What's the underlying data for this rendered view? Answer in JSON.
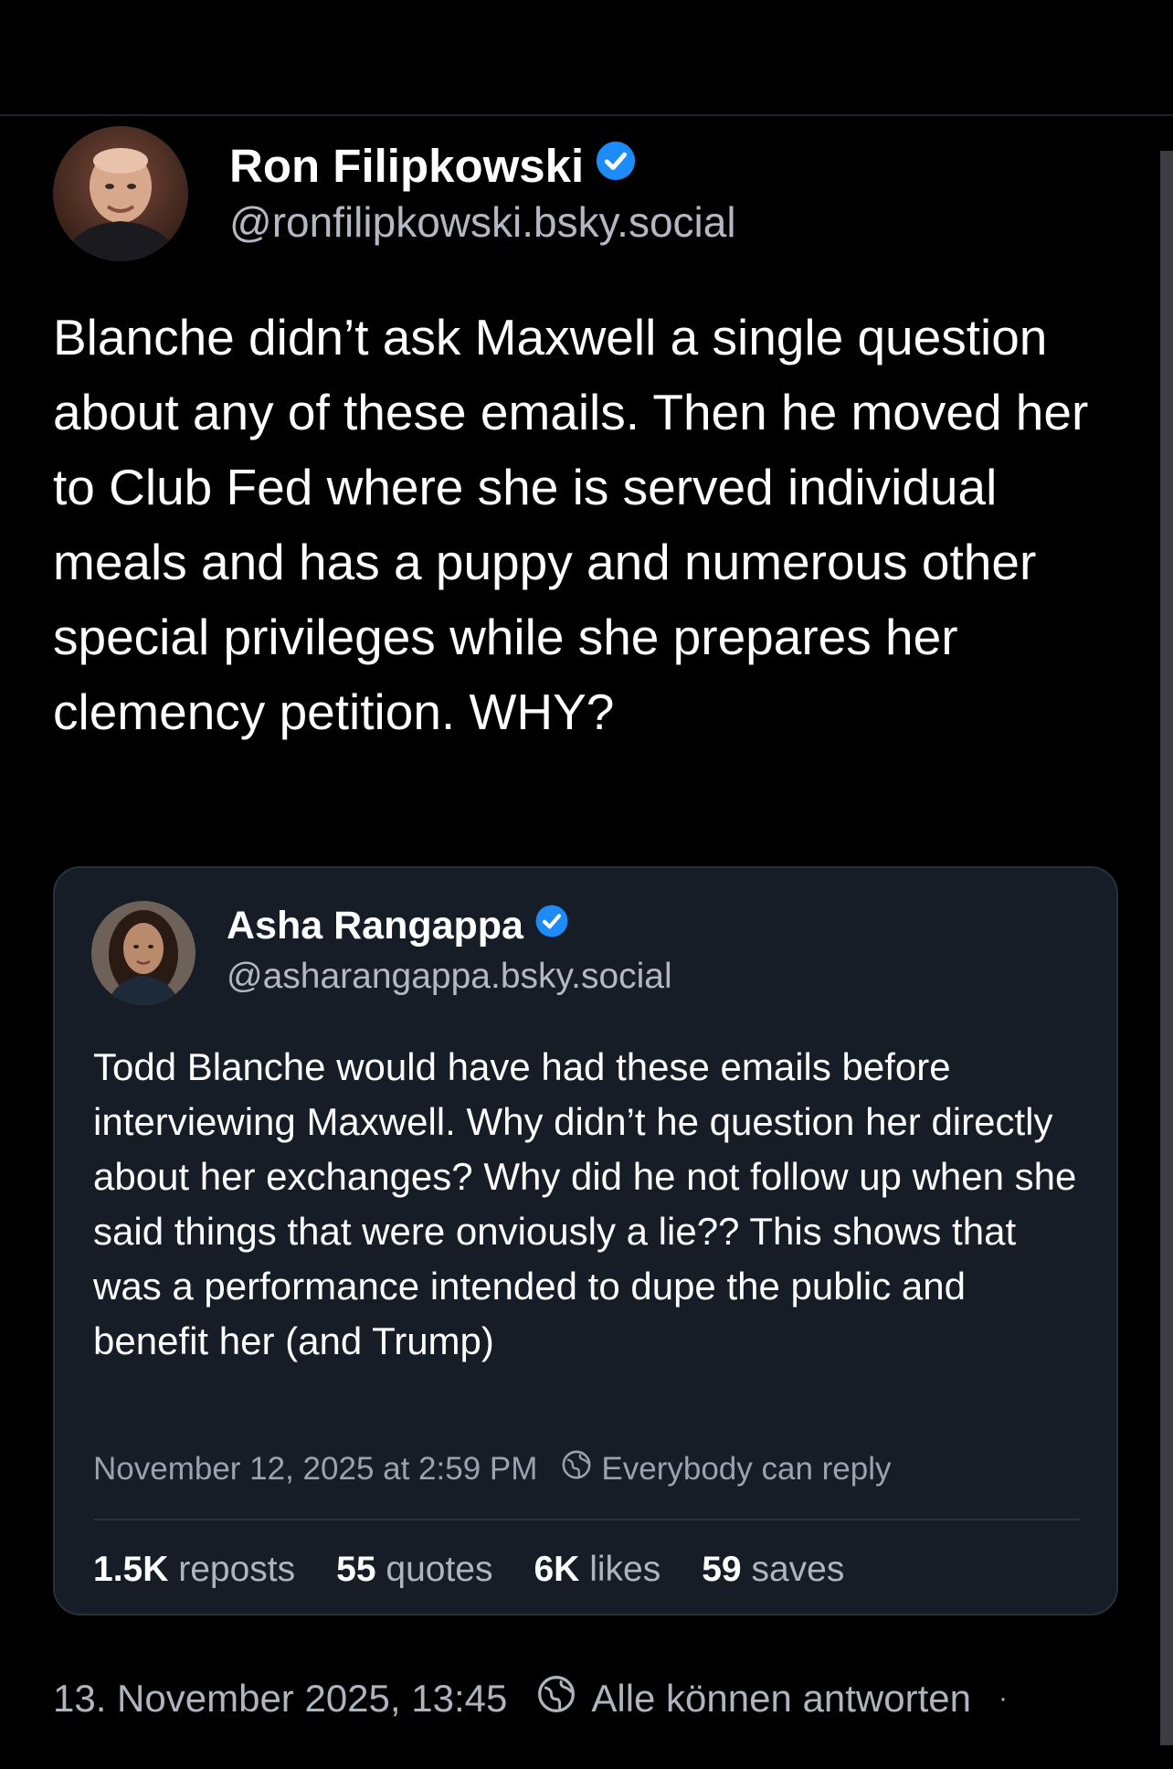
{
  "main_post": {
    "author": {
      "display_name": "Ron Filipkowski",
      "handle": "@ronfilipkowski.bsky.social",
      "verified": true
    },
    "text": "Blanche didn’t ask Maxwell a single question about any of these emails. Then he moved her to Club Fed where she is served individual meals and has a puppy and numerous other special privileges while she prepares her clemency petition. WHY?",
    "timestamp": "13. November 2025, 13:45",
    "reply_setting": "Alle können antworten",
    "trailing_dot": "·"
  },
  "quoted_post": {
    "author": {
      "display_name": "Asha Rangappa",
      "handle": "@asharangappa.bsky.social",
      "verified": true
    },
    "text": "Todd Blanche would have had these emails before interviewing Maxwell. Why didn’t he question her directly about her exchanges? Why did he not follow up when she said things that were onviously a lie?? This shows that was a performance intended to dupe the public and benefit her (and Trump)",
    "timestamp": "November 12, 2025 at 2:59 PM",
    "reply_setting": "Everybody can reply",
    "stats": {
      "reposts": {
        "count": "1.5K",
        "label": "reposts"
      },
      "quotes": {
        "count": "55",
        "label": "quotes"
      },
      "likes": {
        "count": "6K",
        "label": "likes"
      },
      "saves": {
        "count": "59",
        "label": "saves"
      }
    }
  },
  "colors": {
    "background": "#000000",
    "card_background": "#161d27",
    "verified_badge": "#1d8cf8",
    "muted_text": "#aeb5bf"
  },
  "icons": {
    "verified": "verified-check-icon",
    "reply_setting": "globe-icon"
  }
}
